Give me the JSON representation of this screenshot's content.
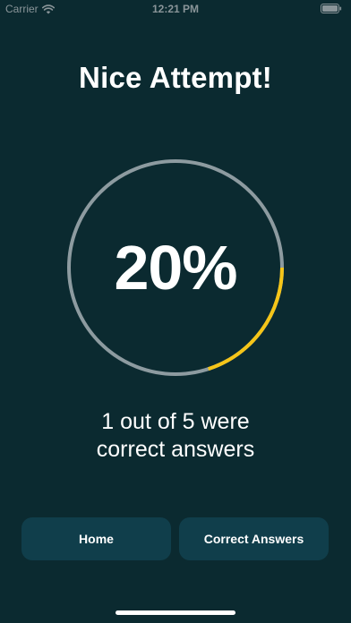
{
  "status_bar": {
    "carrier": "Carrier",
    "time": "12:21 PM",
    "icons": [
      "wifi-icon",
      "battery-icon"
    ]
  },
  "title": "Nice Attempt!",
  "score": {
    "percent_text": "20%",
    "progress": 0.2,
    "colors": {
      "track": "#8d9ba0",
      "progress": "#f5c518"
    }
  },
  "summary": {
    "line1": "1 out of 5 were",
    "line2": "correct answers"
  },
  "buttons": {
    "home": "Home",
    "correct_answers": "Correct Answers"
  },
  "colors": {
    "background": "#0b2a30",
    "button_bg": "#103e4b"
  }
}
